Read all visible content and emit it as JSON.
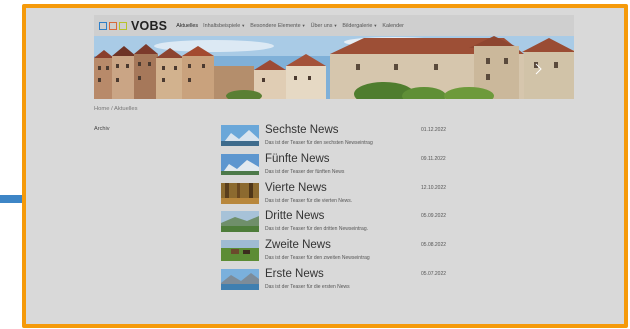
{
  "site": {
    "logo_text": "VOBS",
    "nav": [
      {
        "label": "Aktuelles",
        "active": true,
        "dropdown": false
      },
      {
        "label": "Inhaltsbeispiele",
        "active": false,
        "dropdown": true
      },
      {
        "label": "Besondere Elemente",
        "active": false,
        "dropdown": true
      },
      {
        "label": "Über uns",
        "active": false,
        "dropdown": true
      },
      {
        "label": "Bildergalerie",
        "active": false,
        "dropdown": true
      },
      {
        "label": "Kalender",
        "active": false,
        "dropdown": false
      }
    ],
    "banner_next_icon": "chevron-right-icon"
  },
  "breadcrumb": {
    "home": "Home",
    "separator": "/",
    "current": "Aktuelles"
  },
  "sidebar": {
    "archive_label": "Archiv"
  },
  "news": [
    {
      "title": "Sechste News",
      "teaser": "Das ist der Teaser für den sechsten Newseintrag",
      "date": "01.12.2022",
      "image": "mountain-lake"
    },
    {
      "title": "Fünfte News",
      "teaser": "Das ist der Teaser der fünften News",
      "date": "09.11.2022",
      "image": "alpine-valley"
    },
    {
      "title": "Vierte News",
      "teaser": "Das ist der Teaser für die vierten News.",
      "date": "12.10.2022",
      "image": "autumn-forest"
    },
    {
      "title": "Dritte News",
      "teaser": "Das ist der Teaser für den dritten Newseintrag.",
      "date": "05.09.2022",
      "image": "green-valley"
    },
    {
      "title": "Zweite News",
      "teaser": "Das ist der Teaser für den zweiten Newseintrag",
      "date": "05.08.2022",
      "image": "horses-meadow"
    },
    {
      "title": "Erste News",
      "teaser": "Das ist der Teaser für die ersten News",
      "date": "05.07.2022",
      "image": "lake-mountains"
    }
  ],
  "colors": {
    "frame_border": "#f59a0a",
    "arrow": "#3d85c6",
    "background": "#d9d9d9"
  }
}
